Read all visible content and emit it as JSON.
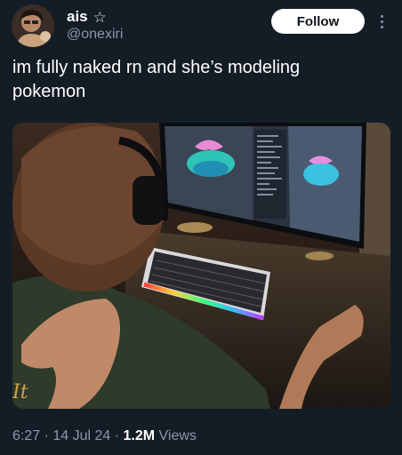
{
  "author": {
    "display_name": "ais",
    "badge_icon": "star-outline-icon",
    "handle": "@onexiri"
  },
  "follow_label": "Follow",
  "more_icon": "more-options-icon",
  "tweet": {
    "text": "im fully naked rn and she’s modeling\npokemon"
  },
  "photo": {
    "icon": "photo-pokemon-modeling-setup"
  },
  "meta": {
    "time": "6:27",
    "separator": " · ",
    "date": "14 Jul 24",
    "views_count": "1.2M",
    "views_label": " Views"
  },
  "colors": {
    "background": "#141d26",
    "primary_text": "#ffffff",
    "secondary_text": "#8b98a5",
    "follow_bg": "#ffffff"
  }
}
